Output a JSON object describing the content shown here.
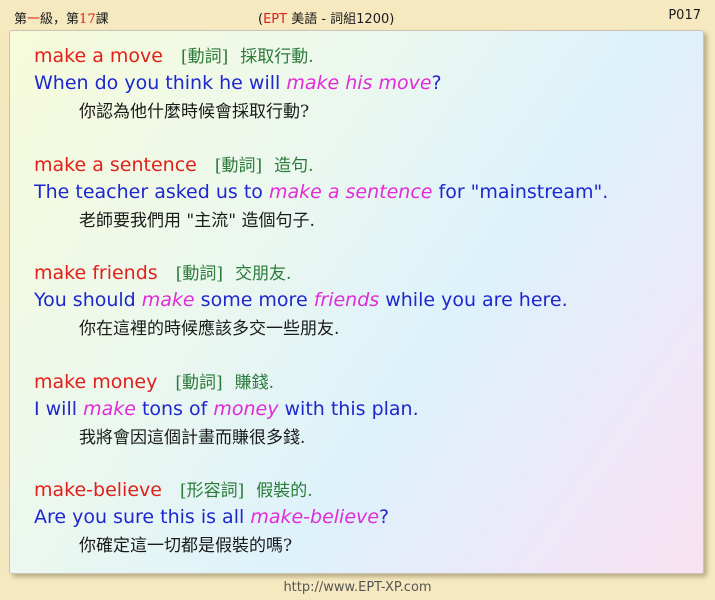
{
  "header": {
    "lesson_prefix": "第",
    "level": "一",
    "lesson_mid": "級，第",
    "lesson_num": "17",
    "lesson_suffix": "課",
    "paren_open": "(",
    "ept": "EPT",
    "center_rest": " 美語 - 詞組1200)",
    "page": "P017"
  },
  "entries": [
    {
      "term": "make a move",
      "pos": "[動詞]",
      "meaning": "採取行動.",
      "sentence": [
        "When do you think he will ",
        "make his move",
        "?"
      ],
      "translation": "你認為他什麼時候會採取行動?"
    },
    {
      "term": "make a sentence",
      "pos": "[動詞]",
      "meaning": "造句.",
      "sentence": [
        "The teacher asked us to ",
        "make a sentence",
        " for \"mainstream\"."
      ],
      "translation": "老師要我們用 \"主流\" 造個句子."
    },
    {
      "term": "make friends",
      "pos": "[動詞]",
      "meaning": "交朋友.",
      "sentence": [
        "You should ",
        "make",
        " some more ",
        "friends",
        " while you are here."
      ],
      "translation": "你在這裡的時候應該多交一些朋友."
    },
    {
      "term": "make money",
      "pos": "[動詞]",
      "meaning": "賺錢.",
      "sentence": [
        "I will ",
        "make",
        " tons of ",
        "money",
        " with this plan."
      ],
      "translation": "我將會因這個計畫而賺很多錢."
    },
    {
      "term": "make-believe",
      "pos": "[形容詞]",
      "meaning": "假裝的.",
      "sentence": [
        "Are you sure this is all ",
        "make-believe",
        "?"
      ],
      "translation": "你確定這一切都是假裝的嗎?"
    }
  ],
  "footer": {
    "url": "http://www.EPT-XP.com"
  }
}
